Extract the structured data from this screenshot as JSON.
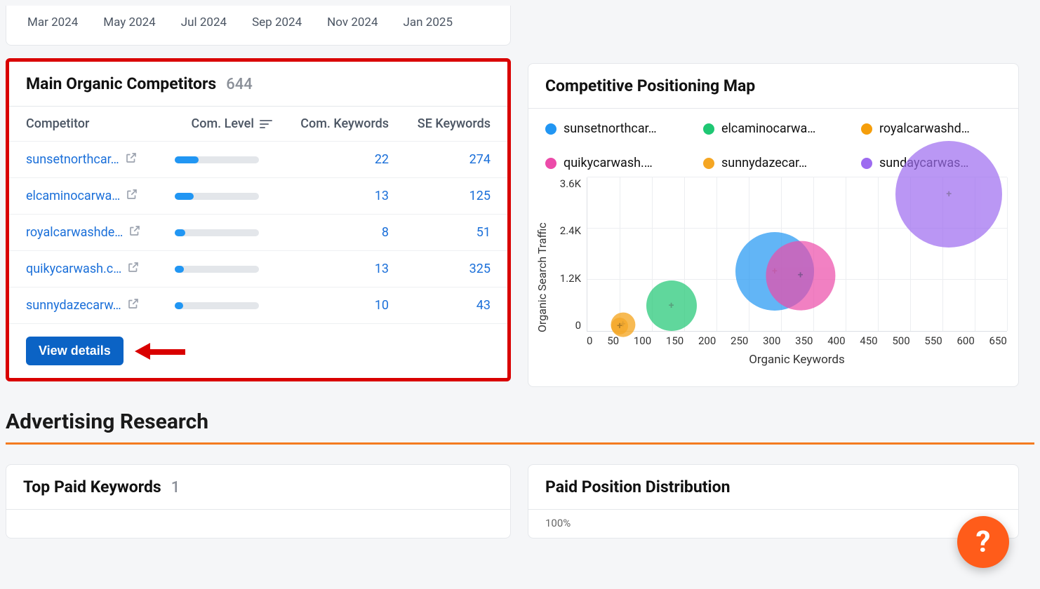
{
  "timeline": [
    "Mar 2024",
    "May 2024",
    "Jul 2024",
    "Sep 2024",
    "Nov 2024",
    "Jan 2025"
  ],
  "competitors": {
    "title": "Main Organic Competitors",
    "count": "644",
    "headers": {
      "competitor": "Competitor",
      "level": "Com. Level",
      "com_kw": "Com. Keywords",
      "se_kw": "SE Keywords"
    },
    "rows": [
      {
        "name": "sunsetnorthcar…",
        "level_pct": 28,
        "com_kw": "22",
        "se_kw": "274"
      },
      {
        "name": "elcaminocarwa…",
        "level_pct": 22,
        "com_kw": "13",
        "se_kw": "125"
      },
      {
        "name": "royalcarwashde…",
        "level_pct": 12,
        "com_kw": "8",
        "se_kw": "51"
      },
      {
        "name": "quikycarwash.c…",
        "level_pct": 11,
        "com_kw": "13",
        "se_kw": "325"
      },
      {
        "name": "sunnydazecarw…",
        "level_pct": 10,
        "com_kw": "10",
        "se_kw": "43"
      }
    ],
    "view_details": "View details"
  },
  "posmap": {
    "title": "Competitive Positioning Map",
    "legend": [
      {
        "label": "sunsetnorthcar…",
        "color": "#2196f3"
      },
      {
        "label": "elcaminocarwa…",
        "color": "#1ec773"
      },
      {
        "label": "royalcarwashd…",
        "color": "#f59e0b"
      },
      {
        "label": "quikycarwash.…",
        "color": "#ec4ba9"
      },
      {
        "label": "sunnydazecar…",
        "color": "#f5a623"
      },
      {
        "label": "sundaycarwas…",
        "color": "#9d6bf0"
      }
    ],
    "ylabel": "Organic Search Traffic",
    "xlabel": "Organic Keywords",
    "yticks": [
      "3.6K",
      "2.4K",
      "1.2K",
      "0"
    ],
    "xticks": [
      "0",
      "50",
      "100",
      "150",
      "200",
      "250",
      "300",
      "350",
      "400",
      "450",
      "500",
      "550",
      "600",
      "650"
    ]
  },
  "chart_data": {
    "type": "scatter",
    "title": "Competitive Positioning Map",
    "xlabel": "Organic Keywords",
    "ylabel": "Organic Search Traffic",
    "xlim": [
      0,
      650
    ],
    "ylim": [
      0,
      3600
    ],
    "series": [
      {
        "name": "sunsetnorthcar…",
        "color": "#2196f3",
        "x": 290,
        "y": 1400,
        "size": 70
      },
      {
        "name": "elcaminocarwa…",
        "color": "#1ec773",
        "x": 130,
        "y": 600,
        "size": 45
      },
      {
        "name": "royalcarwashd…",
        "color": "#f59e0b",
        "x": 55,
        "y": 150,
        "size": 22
      },
      {
        "name": "quikycarwash.…",
        "color": "#ec4ba9",
        "x": 330,
        "y": 1300,
        "size": 62
      },
      {
        "name": "sunnydazecar…",
        "color": "#f5a623",
        "x": 50,
        "y": 120,
        "size": 15
      },
      {
        "name": "sundaycarwas…",
        "color": "#9d6bf0",
        "x": 560,
        "y": 3200,
        "size": 95
      }
    ]
  },
  "ad_research": {
    "title": "Advertising Research",
    "top_paid_kw": {
      "title": "Top Paid Keywords",
      "count": "1"
    },
    "paid_pos_dist": {
      "title": "Paid Position Distribution",
      "ytick": "100%"
    }
  },
  "fab": "?"
}
